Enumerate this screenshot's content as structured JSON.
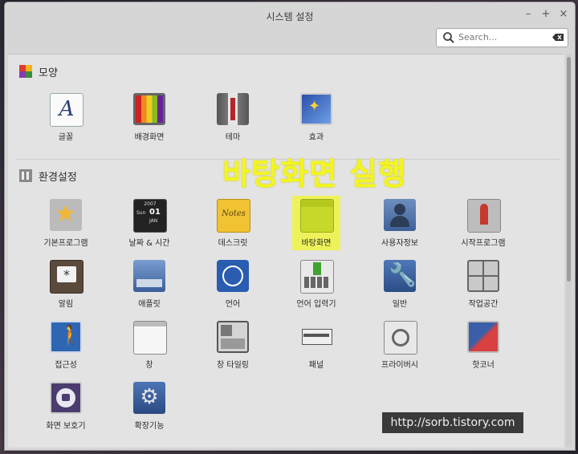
{
  "window": {
    "title": "시스템 설정",
    "minimize": "–",
    "maximize": "+",
    "close": "×"
  },
  "search": {
    "placeholder": "Search...",
    "value": ""
  },
  "sections": {
    "appearance": {
      "title": "모양",
      "items": [
        {
          "label": "글꼴",
          "icon": "font-icon"
        },
        {
          "label": "배경화면",
          "icon": "backgrounds-icon"
        },
        {
          "label": "테마",
          "icon": "themes-icon"
        },
        {
          "label": "효과",
          "icon": "effects-icon"
        }
      ]
    },
    "preferences": {
      "title": "환경설정",
      "items": [
        {
          "label": "기본프로그램",
          "icon": "preferred-apps-icon"
        },
        {
          "label": "날짜 & 시간",
          "icon": "calendar-icon"
        },
        {
          "label": "데스크릿",
          "icon": "desklets-icon"
        },
        {
          "label": "바탕화면",
          "icon": "desktop-icon"
        },
        {
          "label": "사용자정보",
          "icon": "user-icon"
        },
        {
          "label": "시작프로그램",
          "icon": "startup-icon"
        },
        {
          "label": "알림",
          "icon": "notifications-icon"
        },
        {
          "label": "애플릿",
          "icon": "applets-icon"
        },
        {
          "label": "언어",
          "icon": "language-icon"
        },
        {
          "label": "언어 입력기",
          "icon": "input-method-icon"
        },
        {
          "label": "일반",
          "icon": "general-icon"
        },
        {
          "label": "작업공간",
          "icon": "workspaces-icon"
        },
        {
          "label": "접근성",
          "icon": "accessibility-icon"
        },
        {
          "label": "창",
          "icon": "windows-icon"
        },
        {
          "label": "창 타일링",
          "icon": "window-tiling-icon"
        },
        {
          "label": "패널",
          "icon": "panel-icon"
        },
        {
          "label": "프라이버시",
          "icon": "privacy-icon"
        },
        {
          "label": "핫코너",
          "icon": "hot-corners-icon"
        },
        {
          "label": "화면 보호기",
          "icon": "screensaver-icon"
        },
        {
          "label": "확장기능",
          "icon": "extensions-icon"
        }
      ]
    }
  },
  "calendar_icon_text": {
    "year": "2007",
    "day_name": "Sun",
    "day": "01",
    "month": "JAN"
  },
  "desklets_icon_text": "Notes",
  "overlay_caption": "바탕화면 실행",
  "watermark": "http://sorb.tistory.com",
  "colors": {
    "highlight": "#eef25a",
    "caption": "#f4f51e"
  }
}
